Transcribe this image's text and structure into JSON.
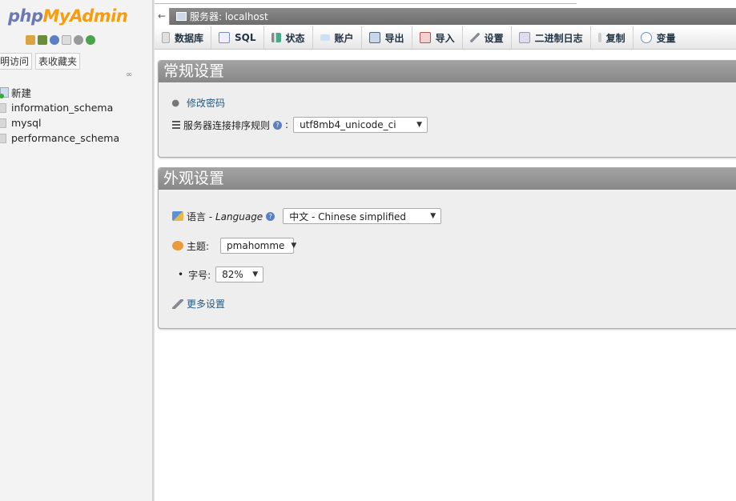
{
  "logo": {
    "php": "php",
    "myadmin": "MyAdmin"
  },
  "nav": {
    "tabs": [
      "最近访问",
      "表收藏夹"
    ],
    "tabs_visible": [
      "明访问",
      "表收藏夹"
    ],
    "tree": [
      {
        "label": "新建",
        "icon": "new-db-icon"
      },
      {
        "label": "information_schema",
        "icon": "database-icon"
      },
      {
        "label": "mysql",
        "icon": "database-icon"
      },
      {
        "label": "performance_schema",
        "icon": "database-icon"
      }
    ]
  },
  "serverbar": {
    "back": "←",
    "server": "服务器: localhost"
  },
  "menu": [
    {
      "label": "数据库",
      "icon": "database-icon"
    },
    {
      "label": "SQL",
      "icon": "sql-icon"
    },
    {
      "label": "状态",
      "icon": "status-icon"
    },
    {
      "label": "账户",
      "icon": "accounts-icon"
    },
    {
      "label": "导出",
      "icon": "export-icon"
    },
    {
      "label": "导入",
      "icon": "import-icon"
    },
    {
      "label": "设置",
      "icon": "settings-icon"
    },
    {
      "label": "二进制日志",
      "icon": "binlog-icon"
    },
    {
      "label": "复制",
      "icon": "replication-icon"
    },
    {
      "label": "变量",
      "icon": "variables-icon"
    }
  ],
  "general": {
    "title": "常规设置",
    "change_password": "修改密码",
    "collation_label": "服务器连接排序规则",
    "collation_value": "utf8mb4_unicode_ci"
  },
  "appearance": {
    "title": "外观设置",
    "language_label": "语言 - ",
    "language_label_en": "Language",
    "language_value": "中文 - Chinese simplified",
    "theme_label": "主题:",
    "theme_value": "pmahomme",
    "fontsize_label": "字号:",
    "fontsize_value": "82%",
    "more_settings": "更多设置"
  },
  "colors": {
    "accent": "#235a81",
    "logo_php": "#6c78af",
    "logo_myadmin": "#f89c0e"
  }
}
